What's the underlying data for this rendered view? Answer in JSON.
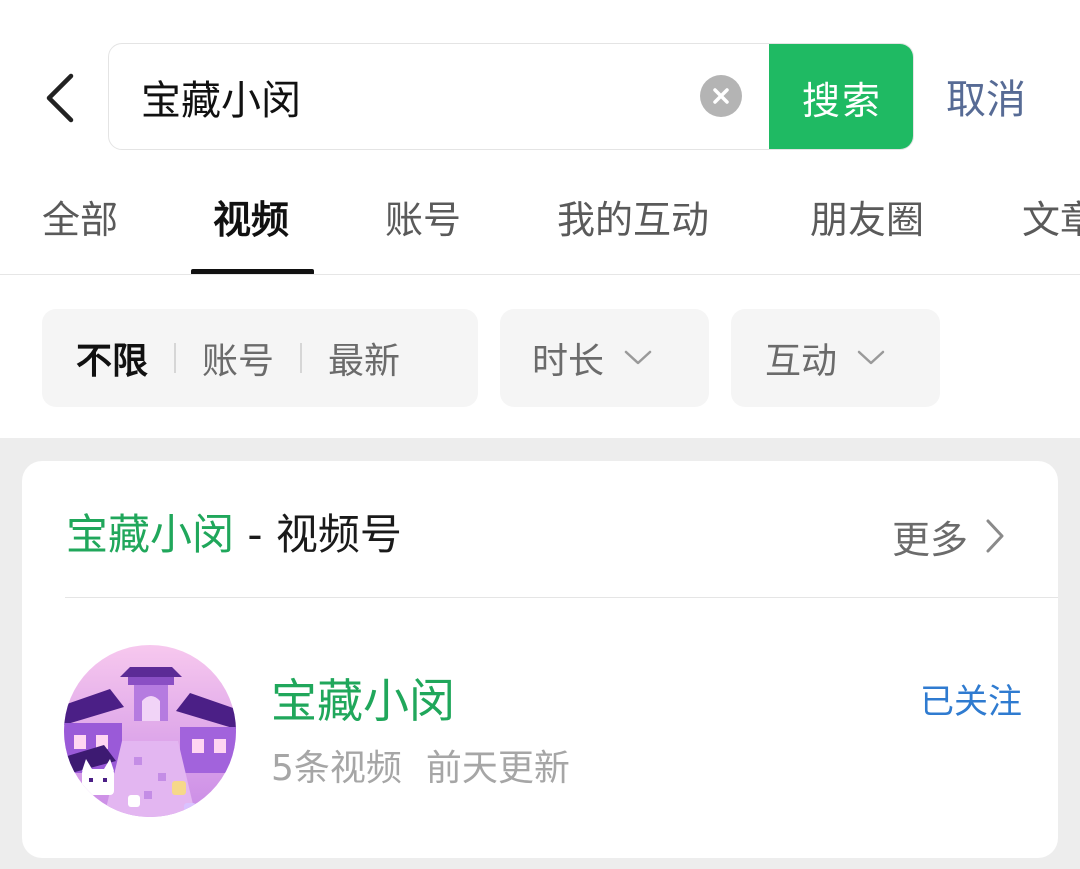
{
  "search": {
    "query": "宝藏小闵",
    "submit_label": "搜索",
    "cancel_label": "取消"
  },
  "tabs": [
    {
      "label": "全部",
      "active": false
    },
    {
      "label": "视频",
      "active": true
    },
    {
      "label": "账号",
      "active": false
    },
    {
      "label": "我的互动",
      "active": false
    },
    {
      "label": "朋友圈",
      "active": false
    },
    {
      "label": "文章",
      "active": false
    }
  ],
  "filters": {
    "sort_options": [
      "不限",
      "账号",
      "最新"
    ],
    "sort_selected": "不限",
    "duration_label": "时长",
    "interaction_label": "互动"
  },
  "result_card": {
    "title_highlight": "宝藏小闵",
    "title_suffix": " - 视频号",
    "more_label": "更多",
    "account": {
      "name": "宝藏小闵",
      "video_count": "5条视频",
      "updated": "前天更新",
      "follow_status": "已关注"
    }
  },
  "colors": {
    "accent_green": "#1fba63",
    "link_blue": "#576b95",
    "follow_blue": "#2f7bd0"
  },
  "icons": [
    "back-arrow-icon",
    "clear-icon",
    "chevron-down-icon",
    "chevron-right-icon"
  ]
}
